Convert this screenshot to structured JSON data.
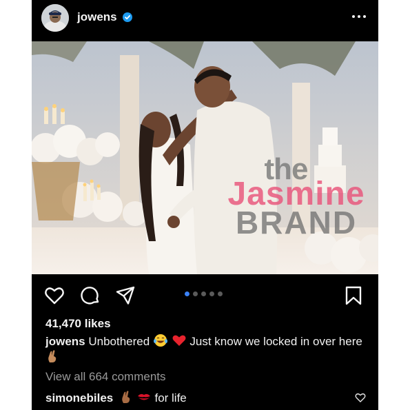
{
  "post": {
    "username": "jowens",
    "verified": true,
    "more_icon": "more-horizontal-icon",
    "carousel": {
      "count": 5,
      "active_index": 0
    },
    "watermark": {
      "line1": "the",
      "line2": "Jasmine",
      "line3": "BRAND"
    },
    "likes_text": "41,470 likes",
    "caption": {
      "username": "jowens",
      "text_before_emoji": "Unbothered",
      "emojis": [
        "laughing-tears-emoji",
        "red-heart-emoji"
      ],
      "text_after_emoji": "Just know we locked in over here",
      "trailing_emoji": "crossed-fingers-emoji"
    },
    "view_comments_text": "View all 664 comments",
    "top_comment": {
      "username": "simonebiles",
      "emojis": [
        "crossed-fingers-emoji",
        "kiss-mark-emoji"
      ],
      "text": "for life"
    }
  },
  "colors": {
    "background": "#000000",
    "text": "#f5f5f5",
    "muted": "#9a9a9a",
    "verified_blue": "#1d9bf0",
    "active_dot": "#3b82f6",
    "watermark_pink": "#e85078"
  }
}
